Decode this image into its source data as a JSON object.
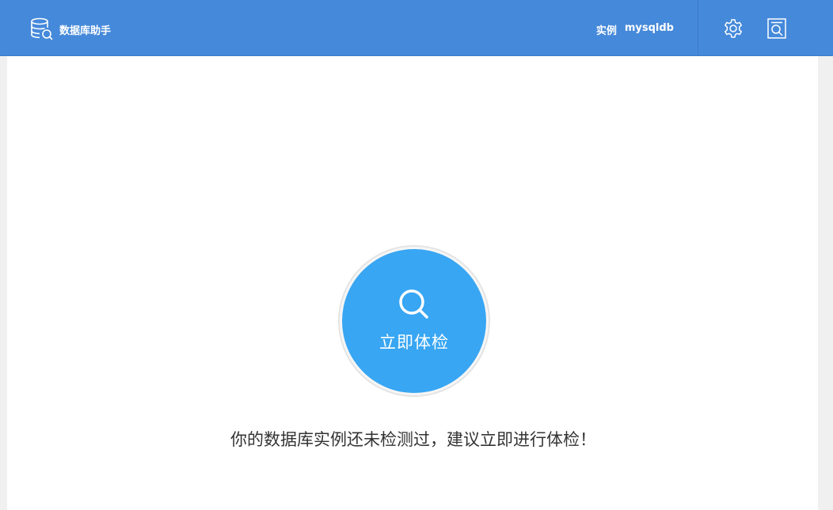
{
  "header": {
    "app_title": "数据库助手",
    "instance_label": "实例",
    "instance_name": "mysqldb",
    "icons": [
      "database-search-icon",
      "gear-icon",
      "report-search-icon"
    ],
    "background_color": "#4589da"
  },
  "main": {
    "check_button_label": "立即体检",
    "check_button_icon": "search-icon",
    "check_button_color": "#38a6f3",
    "hint_text": "你的数据库实例还未检测过，建议立即进行体检！"
  }
}
